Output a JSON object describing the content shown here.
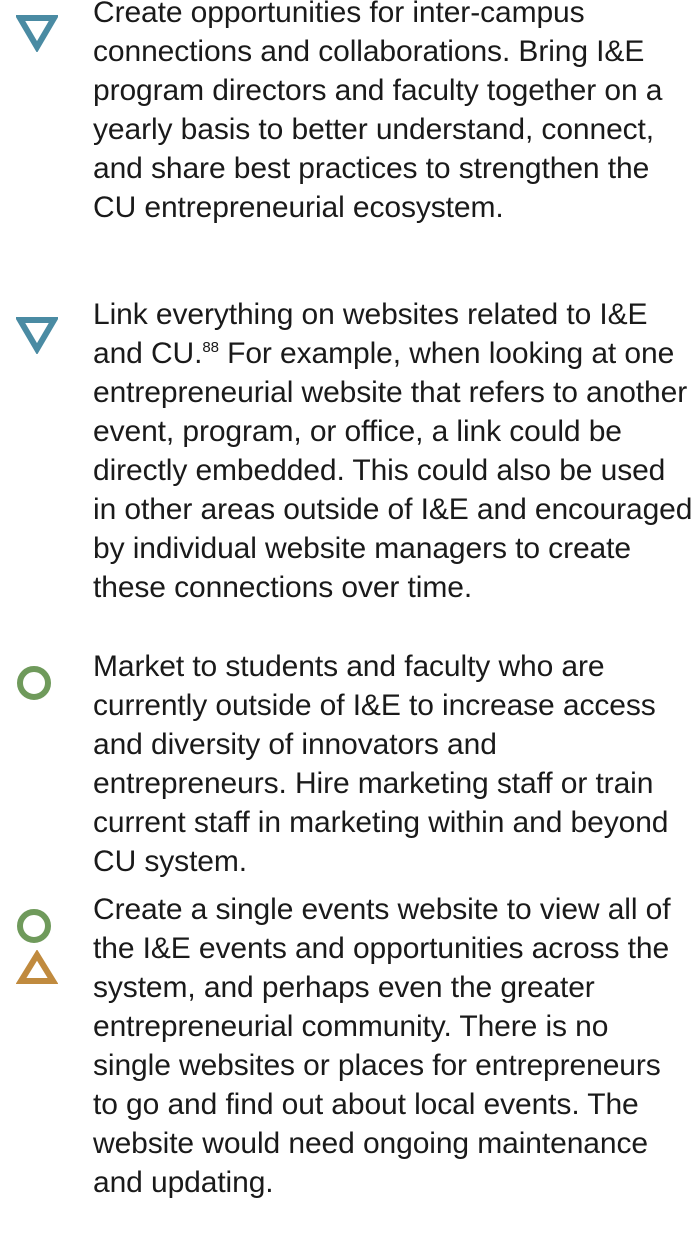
{
  "items": [
    {
      "icons": [
        "triangle-down-icon"
      ],
      "text": "Create opportunities for inter-campus connections and collaborations. Bring I&E program directors and faculty together on a yearly basis to better understand, connect, and share best practices to strengthen the CU entrepreneurial ecosystem."
    },
    {
      "icons": [
        "triangle-down-icon"
      ],
      "text_before": "Link everything on websites related to I&E and CU.",
      "footnote": "88",
      "text_after": " For example, when looking at one entrepreneurial website that refers to another event, program, or office, a link could be directly embedded. This could also be used in other areas outside of I&E and encouraged by individual website managers to create these connections over time."
    },
    {
      "icons": [
        "circle-icon"
      ],
      "text": "Market to students and faculty who are currently outside of I&E to increase access and diversity of innovators and entrepreneurs. Hire marketing staff or train current staff in marketing within and beyond CU system."
    },
    {
      "icons": [
        "circle-icon",
        "triangle-up-icon"
      ],
      "text": "Create a single events website to view all of the I&E events and opportunities across the system, and perhaps even the greater entrepreneurial community. There is no single websites or places for entrepreneurs to go and find out about local events. The website would need ongoing maintenance and updating."
    }
  ],
  "colors": {
    "triangle_down": "#4a8ba3",
    "circle": "#6f9a5b",
    "triangle_up": "#c08a3e",
    "text": "#1a1a1a"
  }
}
